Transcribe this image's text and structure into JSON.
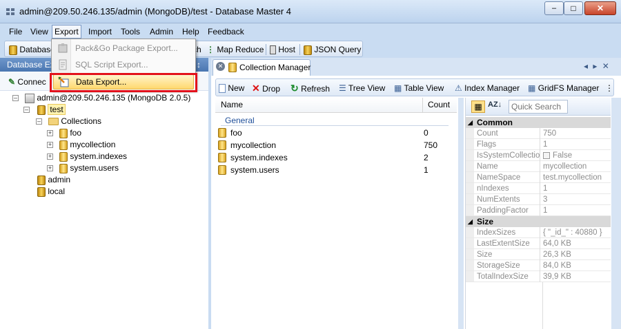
{
  "window": {
    "title": "admin@209.50.246.135/admin (MongoDB)/test - Database Master 4",
    "minimize_glyph": "–",
    "maximize_glyph": "□",
    "close_glyph": "✕"
  },
  "menubar": {
    "items": [
      "File",
      "View",
      "Export",
      "Import",
      "Tools",
      "Admin",
      "Help",
      "Feedback"
    ],
    "active": "Export"
  },
  "toolbar": {
    "items": [
      "Database",
      "ch",
      "Map Reduce",
      "Host",
      "JSON Query"
    ]
  },
  "export_menu": {
    "items": [
      {
        "label": "Pack&Go Package Export...",
        "enabled": false
      },
      {
        "label": "SQL Script Export...",
        "enabled": false
      },
      {
        "label": "Data Export...",
        "enabled": true,
        "highlighted": true
      }
    ]
  },
  "database_explorer": {
    "title": "Database Ex",
    "pin_glyph": "↕",
    "connect_label": "Connec",
    "tree": {
      "server": "admin@209.50.246.135 (MongoDB 2.0.5)",
      "databases": [
        {
          "name": "test",
          "selected": true,
          "collections_label": "Collections",
          "collections": [
            "foo",
            "mycollection",
            "system.indexes",
            "system.users"
          ]
        },
        {
          "name": "admin"
        },
        {
          "name": "local"
        }
      ]
    }
  },
  "collection_manager": {
    "tab_title": "Collection Manager",
    "tab_nav_glyphs": "◂ ▸ ✕",
    "toolbar": [
      "New",
      "Drop",
      "Refresh",
      "Tree View",
      "Table View",
      "Index Manager",
      "GridFS Manager"
    ],
    "grid": {
      "columns": [
        "Name",
        "Count"
      ],
      "group": "General",
      "rows": [
        {
          "name": "foo",
          "count": "0"
        },
        {
          "name": "mycollection",
          "count": "750"
        },
        {
          "name": "system.indexes",
          "count": "2"
        },
        {
          "name": "system.users",
          "count": "1"
        }
      ]
    }
  },
  "properties": {
    "search_placeholder": "Quick Search",
    "categories": [
      {
        "name": "Common",
        "rows": [
          {
            "name": "Count",
            "value": "750"
          },
          {
            "name": "Flags",
            "value": "1"
          },
          {
            "name": "IsSystemCollection",
            "value": "False"
          },
          {
            "name": "Name",
            "value": "mycollection"
          },
          {
            "name": "NameSpace",
            "value": "test.mycollection"
          },
          {
            "name": "nIndexes",
            "value": "1"
          },
          {
            "name": "NumExtents",
            "value": "3"
          },
          {
            "name": "PaddingFactor",
            "value": "1"
          }
        ]
      },
      {
        "name": "Size",
        "rows": [
          {
            "name": "IndexSizes",
            "value": "{ \"_id_\" : 40880 }"
          },
          {
            "name": "LastExtentSize",
            "value": "64,0 KB"
          },
          {
            "name": "Size",
            "value": "26,3 KB"
          },
          {
            "name": "StorageSize",
            "value": "84,0 KB"
          },
          {
            "name": "TotalIndexSize",
            "value": "39,9 KB"
          }
        ]
      }
    ]
  },
  "colors": {
    "highlight_border": "#e3111b",
    "panel_header": "#4a76b1",
    "selected_tree_item": "#fff3b0"
  }
}
